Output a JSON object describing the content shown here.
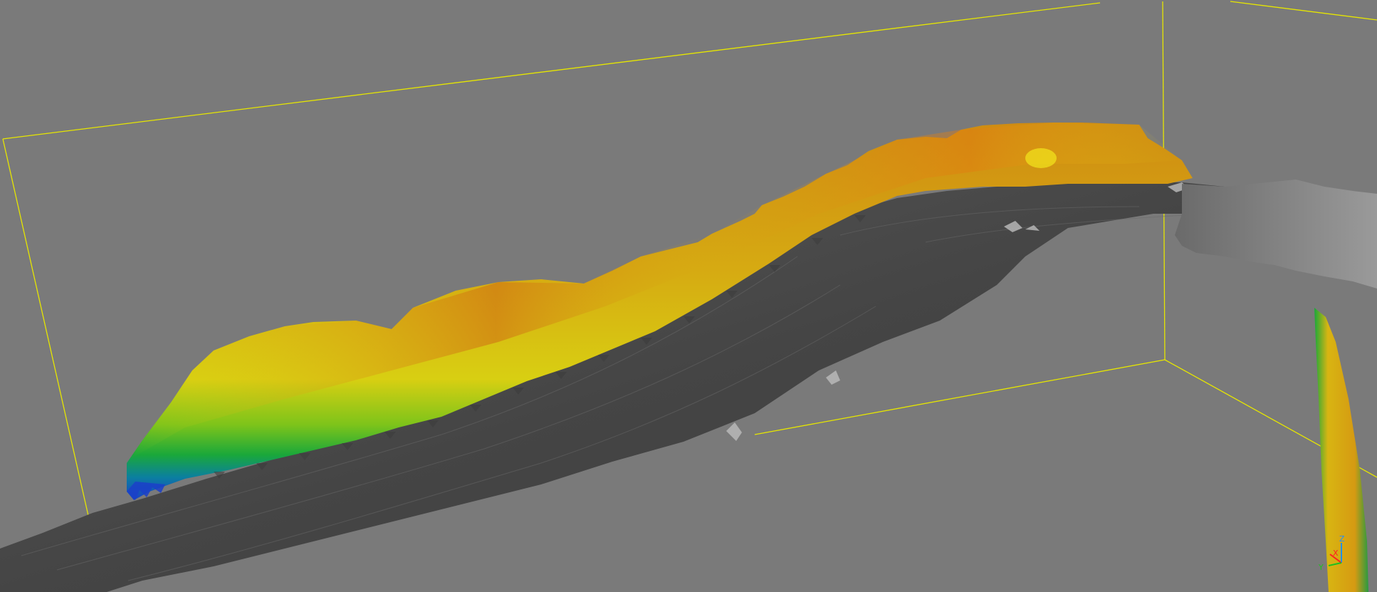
{
  "viewer": {
    "background_color": "#7a7a7a",
    "bounding_box_color": "#e6e600"
  },
  "colormap": {
    "stops": [
      "#1b3fc9",
      "#00a86b",
      "#2fb82a",
      "#9acb12",
      "#e3d117",
      "#d9a70a",
      "#cf7a10"
    ]
  },
  "axis_triad": {
    "x_label": "X",
    "y_label": "Y",
    "z_label": "Z",
    "x_color": "#ff2020",
    "y_color": "#20c020",
    "z_color": "#2090ff"
  }
}
